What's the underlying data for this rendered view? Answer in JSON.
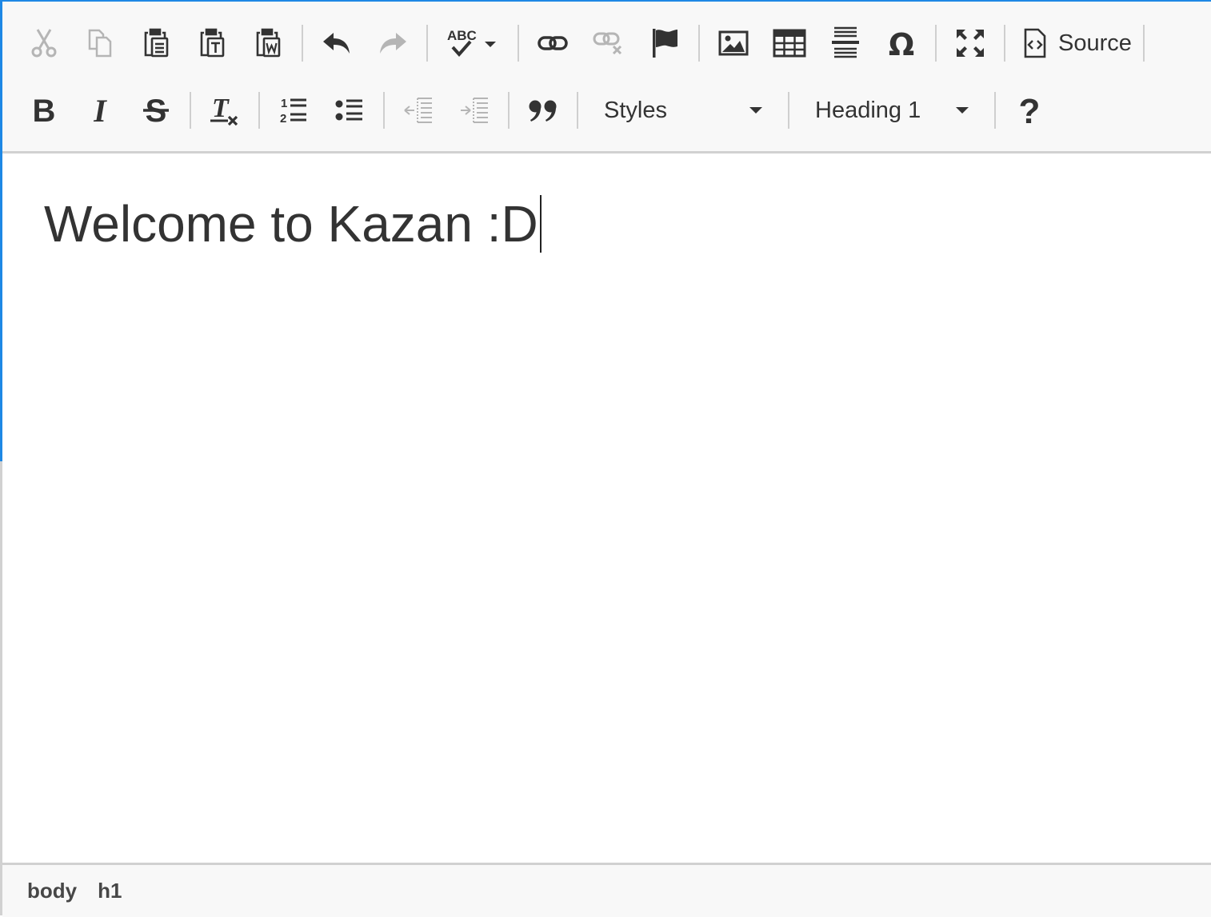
{
  "toolbar": {
    "source_label": "Source",
    "styles_label": "Styles",
    "format_label": "Heading 1",
    "icons": {
      "cut": "cut-icon",
      "copy": "copy-icon",
      "paste": "paste-icon",
      "paste_text": "paste-text-icon",
      "paste_word": "paste-from-word-icon",
      "undo": "undo-icon",
      "redo": "redo-icon",
      "spellcheck": "spellcheck-icon",
      "link": "link-icon",
      "unlink": "unlink-icon",
      "anchor": "anchor-flag-icon",
      "image": "image-icon",
      "table": "table-icon",
      "horizontal_line": "horizontal-line-icon",
      "special_char": "omega-icon",
      "maximize": "maximize-icon",
      "source": "source-icon",
      "bold": "bold-icon",
      "italic": "italic-icon",
      "strike": "strikethrough-icon",
      "remove_format": "remove-format-icon",
      "numbered_list": "numbered-list-icon",
      "bulleted_list": "bulleted-list-icon",
      "outdent": "outdent-icon",
      "indent": "indent-icon",
      "blockquote": "blockquote-icon",
      "help": "help-icon"
    }
  },
  "content": {
    "heading_text": "Welcome to Kazan :D"
  },
  "statusbar": {
    "path": [
      "body",
      "h1"
    ]
  },
  "colors": {
    "focus_border": "#1e88e5",
    "toolbar_bg": "#f8f8f8",
    "icon": "#333333",
    "icon_disabled": "#b5b5b5",
    "text": "#333333"
  }
}
